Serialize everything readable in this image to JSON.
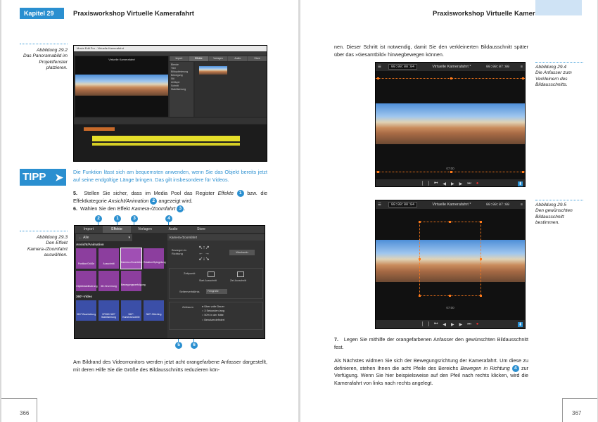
{
  "left_page": {
    "chapter_label": "Kapitel 29",
    "running_head": "Praxisworkshop Virtuelle Kamerafahrt",
    "caption_29_2": {
      "label": "Abbildung 29.2",
      "text": "Das Panoramabild im Projektfenster platzieren."
    },
    "screenshot_29_2": {
      "window_title": "Movie Edit Pro - Virtuelle Kamerafahrt",
      "preview_title": "Virtuelle Kamerafahrt",
      "tabs": [
        "Import",
        "Effekte",
        "Vorlagen",
        "Audio",
        "Store"
      ],
      "list_items": [
        "Blende",
        "Titel",
        "Bildoptimierung",
        "Bewegung",
        "Stil",
        "Zeitlupe",
        "Schnitt",
        "Stabilisierung"
      ]
    },
    "tipp_label": "TIPP",
    "tipp_text": "Die Funktion lässt sich am bequemsten anwenden, wenn Sie das Objekt bereits jetzt auf seine endgültige Länge bringen. Das gilt insbesondere für Videos.",
    "step5": {
      "num": "5.",
      "text_a": "Stellen Sie sicher, dass im Media Pool das Register",
      "em1": "Effekte",
      "mid1": "bzw. die Effektkategorie",
      "em2": "Ansicht/Animation",
      "text_b": "angezeigt wird.",
      "badge1": "1",
      "badge2": "2"
    },
    "step6": {
      "num": "6.",
      "text_a": "Wählen Sie den Effekt",
      "em": "Kamera-/Zoomfahrt",
      "badge": "3"
    },
    "caption_29_3": {
      "label": "Abbildung 29.3",
      "text": "Den Effekt Kamera-/Zoomfahrt auswählen."
    },
    "screenshot_29_3": {
      "tabs": [
        "Import",
        "Effekte",
        "Vorlagen",
        "Audio",
        "Store"
      ],
      "filter": "Alle",
      "section": "Ansicht/Animation",
      "tiles": [
        "Position/Größe",
        "Ausschnitt",
        "Kamera-/Zoomfahrt",
        "Rotation/Spiegelung",
        "Objektstabilisierung",
        "3D-Verzerrung",
        "Bewegungsverfolgung"
      ],
      "section360": "360°-Video",
      "tiles360": [
        "360°-Bearbeitung",
        "VR360 360° Stabilisierung",
        "360°-Kameramodelle",
        "360°-Stitching"
      ],
      "panel_title": "Kamera-/Zoomfahrt",
      "direction_label": "Bewegen in Richtung",
      "reset_label": "Wechseln",
      "points_label": "Zeitpunkt",
      "start_label": "Start-Ausschnitt",
      "end_label": "Ziel-Ausschnitt",
      "aspect_label": "Seitenverhältnis",
      "aspect_value": "Filmgröße",
      "duration_label": "Zeitraum",
      "options": [
        "Über volle Dauer",
        "3 Sekunden lang",
        "50% in der Mitte",
        "Benutzerdefiniert"
      ],
      "markers": [
        "2",
        "1",
        "3",
        "4",
        "5",
        "6"
      ]
    },
    "body_bottom": "Am Bildrand des Videomonitors werden jetzt acht orangefarbene Anfasser dargestellt, mit deren Hilfe Sie die Größe des Bildausschnitts reduzieren kön-",
    "page_number": "366"
  },
  "right_page": {
    "running_head": "Praxisworkshop Virtuelle Kamerafahrt",
    "body_top": "nen. Dieser Schritt ist notwendig, damit Sie den verkleinerten Bildausschnitt später über das »Gesamtbild« hinwegbewegen können.",
    "caption_29_4": {
      "label": "Abbildung 29.4",
      "text": "Die Anfasser zum Verkleinern des Bildausschnitts."
    },
    "caption_29_5": {
      "label": "Abbildung 29.5",
      "text": "Den gewünschten Bildausschnitt bestimmen."
    },
    "monitor": {
      "timecode_left": "00:00:00:04",
      "title": "Virtuelle Kamerafahrt *",
      "timecode_right": "00:00:07:00",
      "scale_mark": "07:00"
    },
    "step7": {
      "num": "7.",
      "text": "Legen Sie mithilfe der orangefarbenen Anfasser den gewünschten Bildausschnitt fest."
    },
    "body_bottom_a": "Als Nächstes widmen Sie sich der Bewegungsrichtung der Kamerafahrt. Um diese zu definieren, stehen Ihnen die acht Pfeile des Bereichs",
    "body_bottom_em": "Bewegen in Richtung",
    "body_bottom_b": "zur Verfügung. Wenn Sie hier beispielsweise auf den Pfeil nach rechts klicken, wird die Kamerafahrt von links nach rechts angelegt.",
    "badge4": "4",
    "page_number": "367"
  }
}
